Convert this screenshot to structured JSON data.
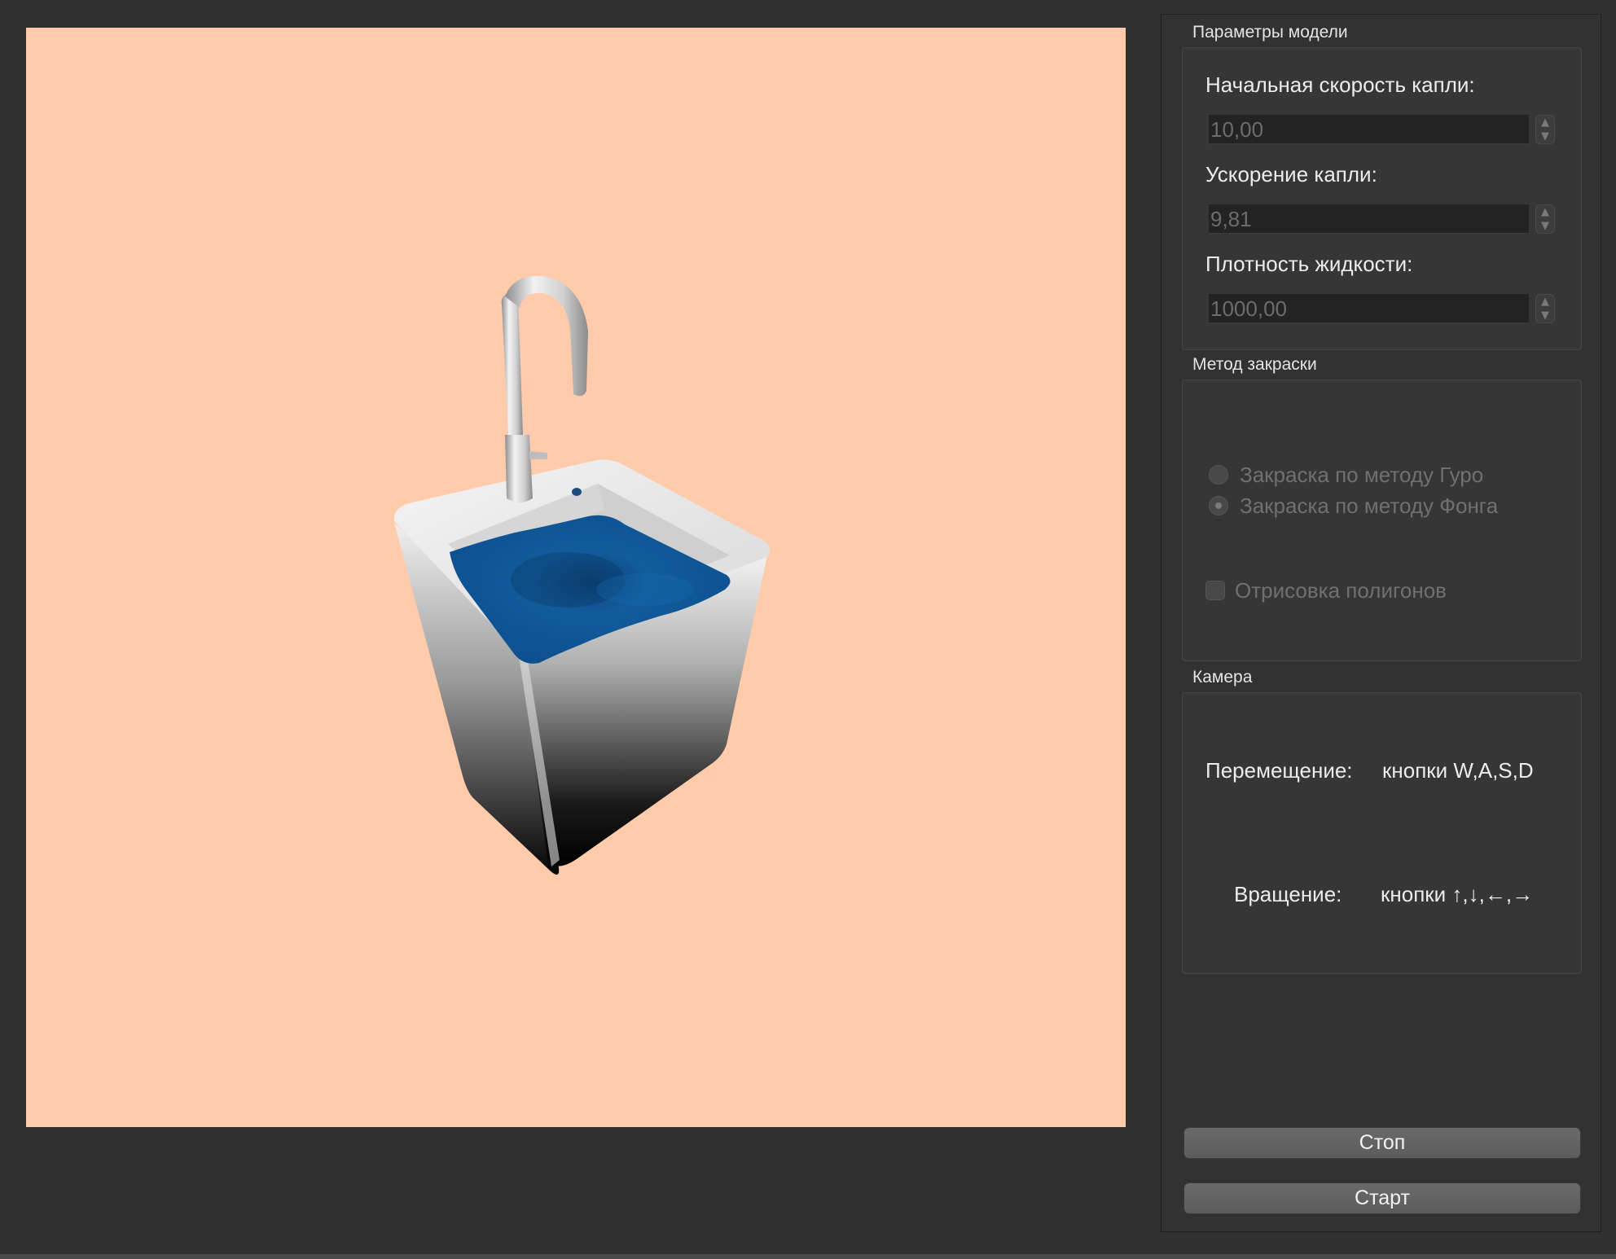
{
  "colors": {
    "window_bg": "#313131",
    "viewport_bg": "#ffcbab",
    "water": "#0f5a9a",
    "sink": "#e6e6e6"
  },
  "viewport": {
    "scene": "sink-with-water-3d-icon"
  },
  "model_params": {
    "title": "Параметры модели",
    "fields": [
      {
        "label": "Начальная скорость капли:",
        "value": "10,00"
      },
      {
        "label": "Ускорение капли:",
        "value": "9,81"
      },
      {
        "label": "Плотность жидкости:",
        "value": "1000,00"
      }
    ],
    "spin_up_icon": "chevron-up-icon",
    "spin_down_icon": "chevron-down-icon"
  },
  "shading": {
    "title": "Метод закраски",
    "radio_gouraud": "Закраска по методу Гуро",
    "radio_phong": "Закраска по методу Фонга",
    "selected": "Закраска по методу Фонга",
    "polygons_checkbox": "Отрисовка полигонов",
    "polygons_checked": false
  },
  "camera": {
    "title": "Камера",
    "move_label": "Перемещение:",
    "move_keys": "кнопки W,A,S,D",
    "rotate_label": "Вращение:",
    "rotate_keys": "кнопки  ↑,↓,←,→"
  },
  "buttons": {
    "stop": "Стоп",
    "start": "Старт"
  }
}
